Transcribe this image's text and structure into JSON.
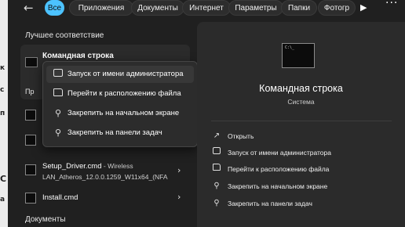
{
  "background_strip": [
    "к",
    "с",
    "п",
    "С",
    "а"
  ],
  "topbar": {
    "back_icon": "arrow-left-icon",
    "chips": [
      "Все",
      "Приложения",
      "Документы",
      "Интернет",
      "Параметры",
      "Папки",
      "Фотогр"
    ],
    "active_chip": "Все",
    "play_glyph": "▶",
    "more_glyph": "···"
  },
  "left": {
    "best_match_heading": "Лучшее соответствие",
    "best_match_title": "Командная строка",
    "partial_heading": "Пр",
    "rows": [
      {
        "title": "Setup_Driver.cmd",
        "subtitle": " - Wireless",
        "line2": "LAN_Atheros_12.0.0.1259_W11x64_(NFA"
      },
      {
        "title": "Install.cmd",
        "subtitle": "",
        "line2": ""
      }
    ],
    "documents_heading": "Документы"
  },
  "context_menu": {
    "items": [
      {
        "label": "Запуск от имени администратора",
        "icon": "shield-icon"
      },
      {
        "label": "Перейти к расположению файла",
        "icon": "folder-icon"
      },
      {
        "label": "Закрепить на начальном экране",
        "icon": "pin-icon"
      },
      {
        "label": "Закрепить на панели задач",
        "icon": "pin-icon"
      }
    ]
  },
  "preview": {
    "title": "Командная строка",
    "subtitle": "Система",
    "actions": [
      {
        "label": "Открыть",
        "icon": "open-icon"
      },
      {
        "label": "Запуск от имени администратора",
        "icon": "shield-icon"
      },
      {
        "label": "Перейти к расположению файла",
        "icon": "folder-icon"
      },
      {
        "label": "Закрепить на начальном экране",
        "icon": "pin-icon"
      },
      {
        "label": "Закрепить на панели задач",
        "icon": "pin-icon"
      }
    ]
  },
  "colors": {
    "accent": "#4cc2ff",
    "background": "#202020",
    "card": "#2b2b2b"
  }
}
